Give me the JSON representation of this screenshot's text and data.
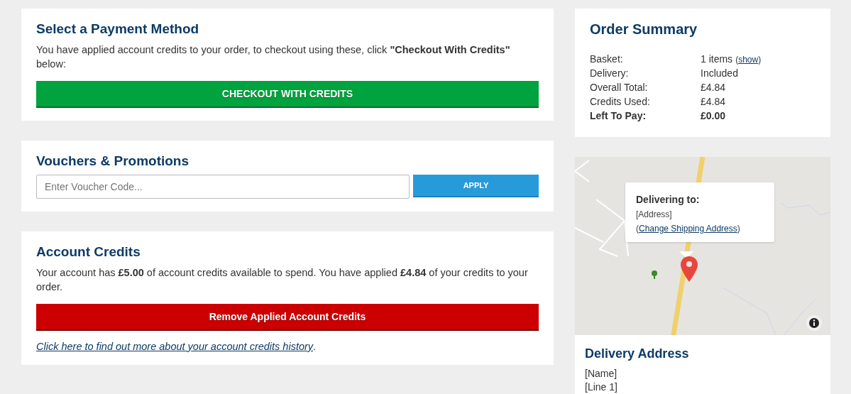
{
  "payment": {
    "title": "Select a Payment Method",
    "text": "You have applied account credits to your order, to checkout using these, click **\"Checkout With Credits\"** below:",
    "button": "CHECKOUT WITH CREDITS"
  },
  "vouchers": {
    "title": "Vouchers & Promotions",
    "placeholder": "Enter Voucher Code...",
    "button": "APPLY"
  },
  "credits": {
    "title": "Account Credits",
    "text": "Your account has **£5.00** of account credits available to spend. You have applied **£4.84** of your credits to your order.",
    "button": "Remove Applied Account Credits",
    "link": "Click here to find out more about your account credits history",
    "link_suffix": "."
  },
  "summary": {
    "title": "Order Summary",
    "rows": [
      {
        "label": "Basket:",
        "value": "1 items",
        "link_open": "(",
        "link": "show",
        "link_close": ")",
        "bold": false
      },
      {
        "label": "Delivery:",
        "value": "Included",
        "bold": false
      },
      {
        "label": "Overall Total:",
        "value": "£4.84",
        "bold": false
      },
      {
        "label": "Credits Used:",
        "value": "£4.84",
        "bold": false
      },
      {
        "label": "Left To Pay:",
        "value": "£0.00",
        "bold": true
      }
    ]
  },
  "map": {
    "popup_title": "Delivering to:",
    "popup_address": "[Address]",
    "popup_link_open": "(",
    "popup_link": "Change Shipping Address",
    "popup_link_close": ")"
  },
  "delivery_address": {
    "title": "Delivery Address",
    "lines": [
      "[Name]",
      "[Line 1]"
    ]
  }
}
